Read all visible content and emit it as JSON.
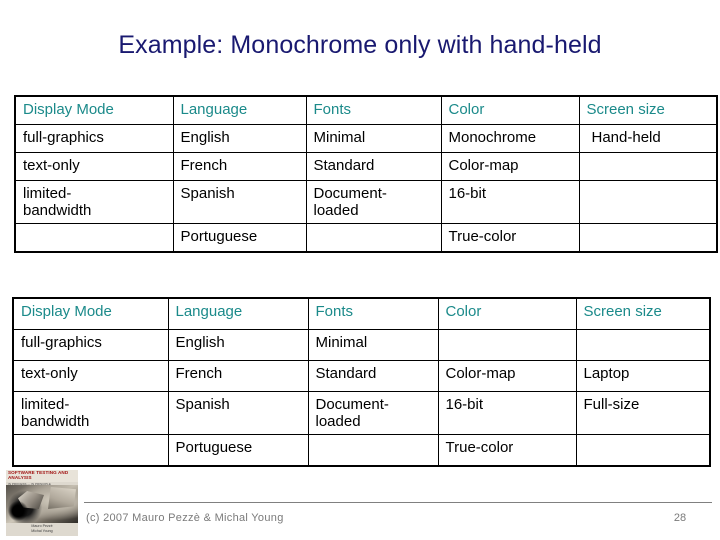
{
  "slide": {
    "title": "Example: Monochrome only with hand-held",
    "page_number": "28",
    "title_color": "#191970",
    "header_color": "#1b8a8a",
    "footer_color": "#7a7a7a"
  },
  "tables": {
    "table_one": {
      "headers": [
        "Display Mode",
        "Language",
        "Fonts",
        "Color",
        "Screen size"
      ],
      "rows": [
        [
          "full-graphics",
          "English",
          "Minimal",
          "Monochrome",
          "Hand-held"
        ],
        [
          "text-only",
          "French",
          "Standard",
          "Color-map",
          ""
        ],
        [
          "limited-\nbandwidth",
          "Spanish",
          "Document-\nloaded",
          "16-bit",
          ""
        ],
        [
          "",
          "Portuguese",
          "",
          "True-color",
          ""
        ]
      ]
    },
    "table_two": {
      "headers": [
        "Display Mode",
        "Language",
        "Fonts",
        "Color",
        "Screen size"
      ],
      "rows": [
        [
          "full-graphics",
          "English",
          "Minimal",
          "",
          ""
        ],
        [
          "text-only",
          "French",
          "Standard",
          "Color-map",
          "Laptop"
        ],
        [
          "limited-\nbandwidth",
          "Spanish",
          "Document-\nloaded",
          "16-bit",
          "Full-size"
        ],
        [
          "",
          "Portuguese",
          "",
          "True-color",
          ""
        ]
      ]
    }
  },
  "footer": {
    "credit": "(c) 2007 Mauro Pezzè & Michal Young",
    "page": "28"
  },
  "book_cover": {
    "title": "SOFTWARE TESTING AND ANALYSIS",
    "subtitle": "IN PROCESS — IN PRINCIPLE",
    "authors": "Mauro Pezzè\nMichal Young"
  }
}
